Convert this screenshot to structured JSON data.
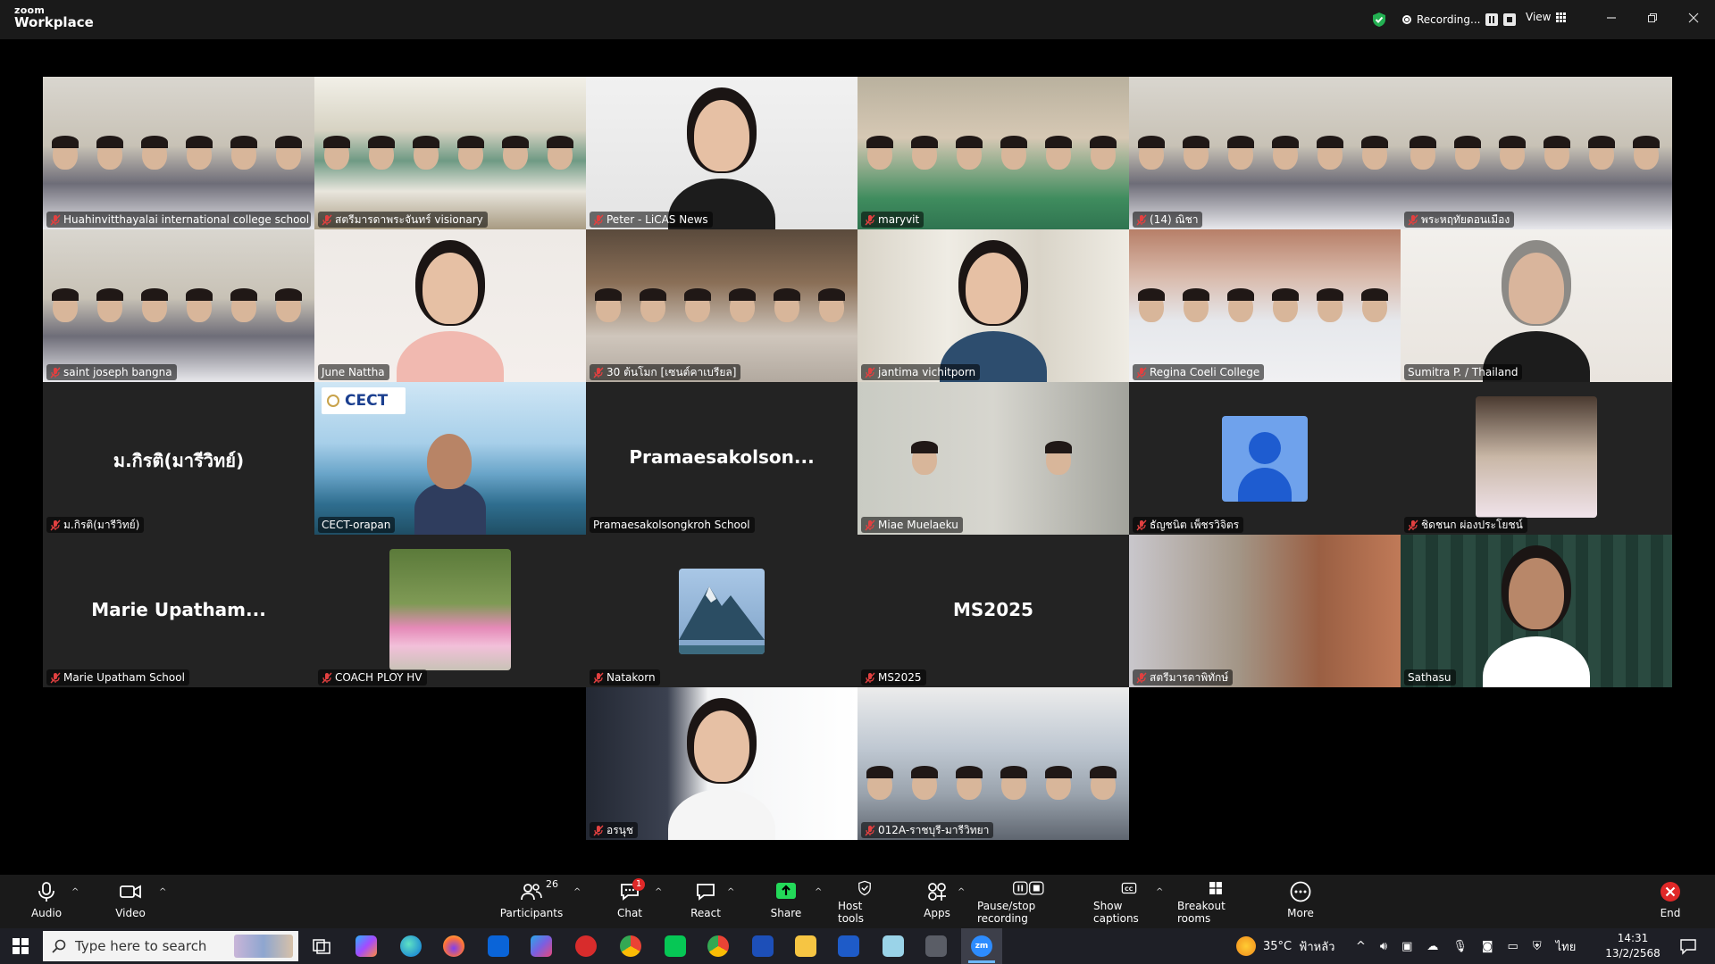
{
  "app": {
    "brand_top": "zoom",
    "brand_bottom": "Workplace"
  },
  "topbar": {
    "recording_label": "Recording...",
    "view_label": "View"
  },
  "participants": [
    {
      "name": "Huahinvitthayalai international college school",
      "scene": "classroom"
    },
    {
      "name": "สตรีมารดาพระจันทร์ visionary",
      "scene": "hall"
    },
    {
      "name": "Peter - LiCAS News",
      "scene": "portrait"
    },
    {
      "name": "maryvit",
      "scene": "group-green"
    },
    {
      "name": "(14) ณิชา",
      "scene": "classroom"
    },
    {
      "name": "พระหฤทัยดอนเมือง",
      "scene": "classroom"
    },
    {
      "name": "saint joseph bangna",
      "scene": "classroom"
    },
    {
      "name": "June Nattha",
      "scene": "portrait-light"
    },
    {
      "name": "30 ต้นโมก [เซนต์คาเบรียล]",
      "scene": "group-dark"
    },
    {
      "name": "jantima vichitporn",
      "scene": "portrait-curtain"
    },
    {
      "name": "Regina Coeli College",
      "scene": "selfie"
    },
    {
      "name": "Sumitra P. / Thailand",
      "scene": "portrait-elder"
    },
    {
      "name": "ม.กิรติ(มารีวิทย์)",
      "display": "ม.กิรติ(มารีวิทย์)",
      "scene": "name-only"
    },
    {
      "name": "CECT-orapan",
      "scene": "cect",
      "logo_text": "CECT"
    },
    {
      "name": "Pramaesakolsongkroh School",
      "display": "Pramaesakolson...",
      "scene": "name-only"
    },
    {
      "name": "Miae Muelaeku",
      "scene": "two-boys"
    },
    {
      "name": "ธัญชนิต เพ็ชรวิจิตร",
      "scene": "avatar-default"
    },
    {
      "name": "ชิดชนก ผ่องประโยชน์",
      "scene": "avatar-photo"
    },
    {
      "name": "Marie Upatham School",
      "display": "Marie Upatham...",
      "scene": "name-only"
    },
    {
      "name": "COACH PLOY HV",
      "scene": "avatar-flowers"
    },
    {
      "name": "Natakorn",
      "scene": "avatar-mountain"
    },
    {
      "name": "MS2025",
      "display": "MS2025",
      "scene": "name-only"
    },
    {
      "name": "สตรีมารดาพิทักษ์",
      "scene": "blurred"
    },
    {
      "name": "Sathasu",
      "scene": "portrait-smile",
      "active": true
    },
    {
      "name": "อรนุช",
      "scene": "portrait-office"
    },
    {
      "name": "012A-ราชบุรี-มารีวิทยา",
      "scene": "meeting-room"
    }
  ],
  "toolbar": {
    "audio": "Audio",
    "video": "Video",
    "participants": "Participants",
    "participants_count": "26",
    "chat": "Chat",
    "chat_badge": "1",
    "react": "React",
    "share": "Share",
    "host_tools": "Host tools",
    "apps": "Apps",
    "pause_stop_recording": "Pause/stop recording",
    "show_captions": "Show captions",
    "breakout_rooms": "Breakout rooms",
    "more": "More",
    "end": "End"
  },
  "taskbar": {
    "search_placeholder": "Type here to search",
    "weather_temp": "35°C",
    "weather_desc": "ฟ้าหลัว",
    "language": "ไทย",
    "time": "14:31",
    "date": "13/2/2568"
  },
  "colors": {
    "active_speaker": "#23d959",
    "share_green": "#23d959",
    "end_red": "#e02828",
    "tile_bg": "#232323"
  }
}
